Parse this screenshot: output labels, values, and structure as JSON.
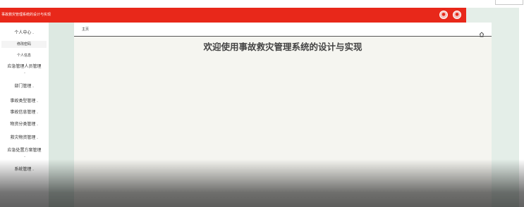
{
  "app": {
    "title": "事故救灾管理系统的设计与实现"
  },
  "header": {
    "buttons": [
      {
        "icon": "circle-icon"
      },
      {
        "icon": "circle-icon"
      }
    ]
  },
  "sidebar": {
    "items": [
      {
        "label": "个人中心",
        "expandable": true,
        "children": [
          {
            "label": "修改密码",
            "active": true
          },
          {
            "label": "个人信息",
            "active": false
          }
        ]
      },
      {
        "label": "应急管理人员管理",
        "expandable": true
      },
      {
        "label": "部门管理",
        "expandable": true
      },
      {
        "label": "事故类型管理",
        "expandable": true
      },
      {
        "label": "事故信息管理",
        "expandable": true
      },
      {
        "label": "物资分类管理",
        "expandable": true
      },
      {
        "label": "救灾物资管理",
        "expandable": true
      },
      {
        "label": "应急处置方案管理",
        "expandable": true
      },
      {
        "label": "系统管理",
        "expandable": true
      }
    ]
  },
  "main": {
    "breadcrumb": "主页",
    "welcome": "欢迎使用事故救灾管理系统的设计与实现"
  },
  "colors": {
    "header": "#e8281a",
    "side_panel": "#dde9e2",
    "content_bg": "#f5f5f0"
  }
}
